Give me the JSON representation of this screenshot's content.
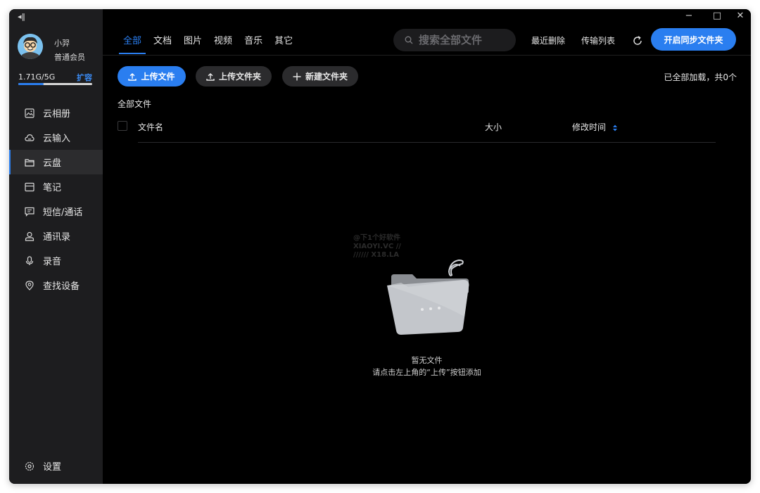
{
  "user": {
    "name": "小羿",
    "level": "普通会员",
    "storage_text": "1.71G/5G",
    "storage_fraction": 0.342,
    "expand_label": "扩容"
  },
  "sidebar": {
    "items": [
      {
        "label": "云相册",
        "icon": "photo-album-icon"
      },
      {
        "label": "云输入",
        "icon": "cloud-input-icon"
      },
      {
        "label": "云盘",
        "icon": "folder-icon"
      },
      {
        "label": "笔记",
        "icon": "note-icon"
      },
      {
        "label": "短信/通话",
        "icon": "message-icon"
      },
      {
        "label": "通讯录",
        "icon": "contacts-icon"
      },
      {
        "label": "录音",
        "icon": "microphone-icon"
      },
      {
        "label": "查找设备",
        "icon": "location-icon"
      }
    ],
    "active_index": 2,
    "settings_label": "设置"
  },
  "header": {
    "tabs": [
      "全部",
      "文档",
      "图片",
      "视频",
      "音乐",
      "其它"
    ],
    "active_tab": 0,
    "search_placeholder": "搜索全部文件",
    "recently_deleted": "最近删除",
    "transfer_list": "传输列表",
    "sync_button": "开启同步文件夹"
  },
  "toolbar": {
    "upload_file": "上传文件",
    "upload_folder": "上传文件夹",
    "new_folder": "新建文件夹",
    "loaded_status": "已全部加载，共0个"
  },
  "list": {
    "breadcrumb": "全部文件",
    "col_name": "文件名",
    "col_size": "大小",
    "col_modified": "修改时间"
  },
  "empty": {
    "title": "暂无文件",
    "hint": "请点击左上角的“上传”按钮添加"
  },
  "watermark": {
    "line1": "@下1个好软件",
    "line2": "XIAOYI.VC //",
    "line3": "////// X18.LA"
  },
  "colors": {
    "accent": "#2a7ef0",
    "sidebar_bg": "#1d1d1f",
    "main_bg": "#000000"
  }
}
